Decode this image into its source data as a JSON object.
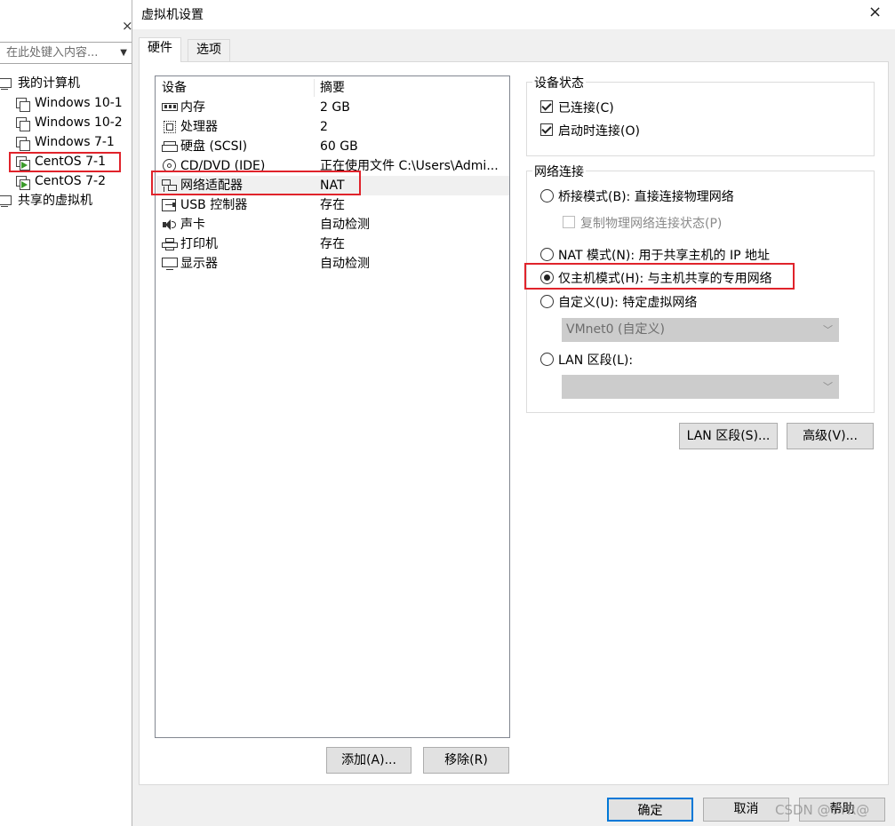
{
  "library": {
    "search_placeholder": "在此处键入内容...",
    "close_symbol": "×",
    "my_computer": "我的计算机",
    "vms": [
      "Windows 10-1",
      "Windows 10-2",
      "Windows 7-1",
      "CentOS 7-1",
      "CentOS 7-2"
    ],
    "shared": "共享的虚拟机"
  },
  "dialog": {
    "title": "虚拟机设置",
    "close_symbol": "×",
    "tabs": [
      "硬件",
      "选项"
    ],
    "active_tab": "硬件"
  },
  "devices": {
    "headers": [
      "设备",
      "摘要"
    ],
    "rows": [
      {
        "name": "内存",
        "summary": "2 GB",
        "icon": "memory-icon"
      },
      {
        "name": "处理器",
        "summary": "2",
        "icon": "processor-icon"
      },
      {
        "name": "硬盘 (SCSI)",
        "summary": "60 GB",
        "icon": "hard-disk-icon"
      },
      {
        "name": "CD/DVD (IDE)",
        "summary": "正在使用文件 C:\\Users\\Admi...",
        "icon": "cd-dvd-icon"
      },
      {
        "name": "网络适配器",
        "summary": "NAT",
        "icon": "network-adapter-icon"
      },
      {
        "name": "USB 控制器",
        "summary": "存在",
        "icon": "usb-icon"
      },
      {
        "name": "声卡",
        "summary": "自动检测",
        "icon": "sound-card-icon"
      },
      {
        "name": "打印机",
        "summary": "存在",
        "icon": "printer-icon"
      },
      {
        "name": "显示器",
        "summary": "自动检测",
        "icon": "display-icon"
      }
    ],
    "add_button": "添加(A)...",
    "remove_button": "移除(R)"
  },
  "device_status": {
    "title": "设备状态",
    "connected": "已连接(C)",
    "connect_at_power_on": "启动时连接(O)"
  },
  "network": {
    "title": "网络连接",
    "bridged": "桥接模式(B): 直接连接物理网络",
    "replicate": "复制物理网络连接状态(P)",
    "nat": "NAT 模式(N): 用于共享主机的 IP 地址",
    "host_only": "仅主机模式(H): 与主机共享的专用网络",
    "custom": "自定义(U): 特定虚拟网络",
    "custom_select": "VMnet0 (自定义)",
    "lan": "LAN 区段(L):",
    "lan_select": "",
    "selected": "host_only"
  },
  "buttons": {
    "lan_segments": "LAN 区段(S)...",
    "advanced": "高级(V)...",
    "ok": "确定",
    "cancel": "取消",
    "help": "帮助"
  },
  "watermark": "CSDN @YYR@",
  "colors": {
    "highlight_box": "#e0232b",
    "default_button_border": "#0078d7",
    "running_icon": "#3a9a2a"
  }
}
